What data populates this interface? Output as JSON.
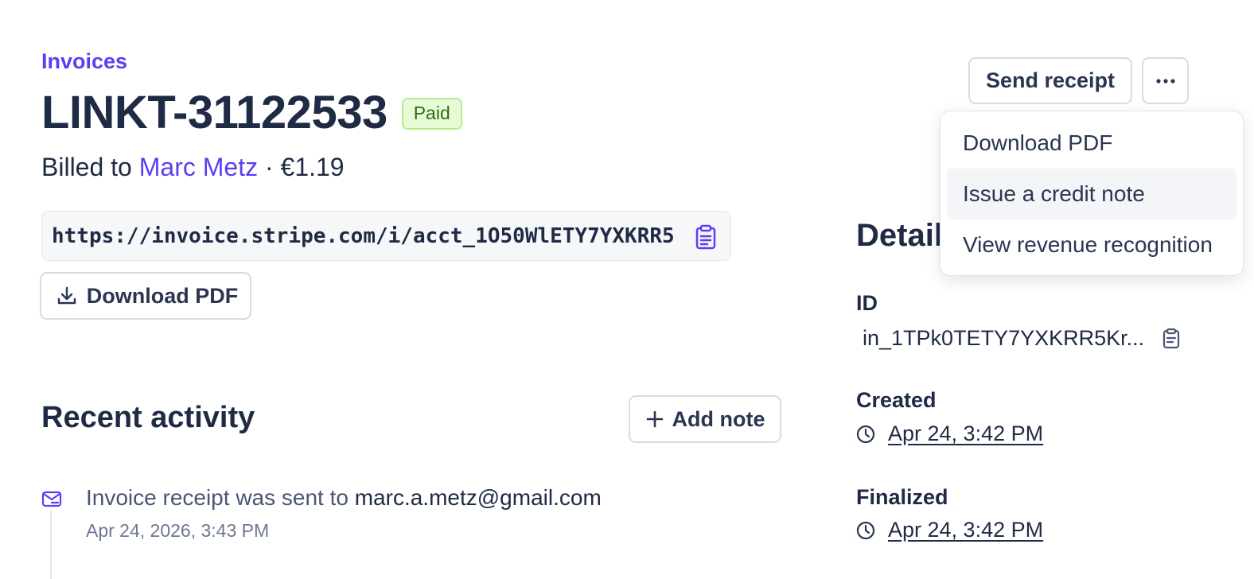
{
  "breadcrumb": "Invoices",
  "invoice": {
    "number": "LINKT-31122533",
    "status": "Paid",
    "billed_prefix": "Billed to",
    "customer": "Marc Metz",
    "separator": "·",
    "amount": "€1.19",
    "url": "https://invoice.stripe.com/i/acct_1O50WlETY7YXKRR5"
  },
  "actions": {
    "download_pdf": "Download PDF",
    "send_receipt": "Send receipt",
    "more": "···"
  },
  "menu": {
    "items": [
      {
        "label": "Download PDF"
      },
      {
        "label": "Issue a credit note"
      },
      {
        "label": "View revenue recognition"
      }
    ]
  },
  "activity": {
    "title": "Recent activity",
    "add_note": "Add note",
    "items": [
      {
        "text_prefix": "Invoice receipt was sent to",
        "email": "marc.a.metz@gmail.com",
        "time": "Apr 24, 2026, 3:43 PM"
      }
    ]
  },
  "details": {
    "title": "Details",
    "id_label": "ID",
    "id_value": "in_1TPk0TETY7YXKRR5Kr...",
    "created_label": "Created",
    "created_value": "Apr 24, 3:42 PM",
    "finalized_label": "Finalized",
    "finalized_value": "Apr 24, 3:42 PM"
  },
  "colors": {
    "accent": "#5b3df5",
    "text": "#1f2a44",
    "paid_bg": "#e7fbd6",
    "paid_border": "#b8ec8d",
    "paid_text": "#2f6b12"
  }
}
